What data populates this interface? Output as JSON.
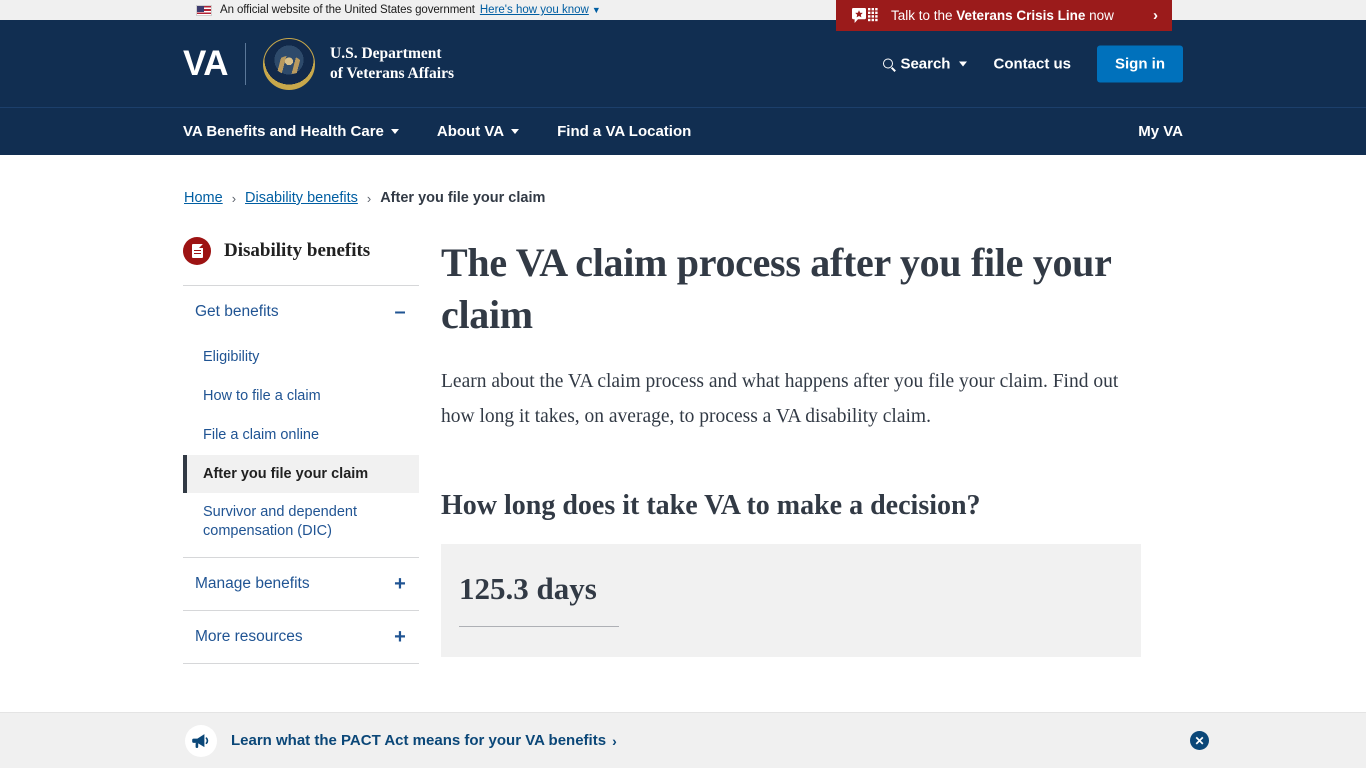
{
  "gov_banner": {
    "text": "An official website of the United States government",
    "how_you_know": "Here's how you know",
    "flag_icon": "us-flag-icon"
  },
  "crisis_banner": {
    "prefix": "Talk to the ",
    "bold": "Veterans Crisis Line",
    "suffix": " now",
    "arrow": "›",
    "icon": "crisis-chat-icon",
    "bg_color": "#9b1b1b"
  },
  "masthead": {
    "logo_text": "VA",
    "seal_icon": "va-seal-icon",
    "dept_line1": "U.S. Department",
    "dept_line2": "of Veterans Affairs",
    "search_label": "Search",
    "search_icon": "search-icon",
    "contact_label": "Contact us",
    "signin_label": "Sign in",
    "signin_color": "#0071bc",
    "bg_color": "#112e51"
  },
  "nav": {
    "items": [
      {
        "label": "VA Benefits and Health Care",
        "has_caret": true
      },
      {
        "label": "About VA",
        "has_caret": true
      },
      {
        "label": "Find a VA Location",
        "has_caret": false
      }
    ],
    "my_va": "My VA"
  },
  "breadcrumb": {
    "home": "Home",
    "parent": "Disability benefits",
    "current": "After you file your claim",
    "separator": "›"
  },
  "sidebar": {
    "title": "Disability benefits",
    "title_icon": "document-icon",
    "groups": [
      {
        "label": "Get benefits",
        "toggle": "–",
        "expanded": true,
        "items": [
          {
            "label": "Eligibility",
            "active": false
          },
          {
            "label": "How to file a claim",
            "active": false
          },
          {
            "label": "File a claim online",
            "active": false
          },
          {
            "label": "After you file your claim",
            "active": true
          },
          {
            "label": "Survivor and dependent compensation (DIC)",
            "active": false
          }
        ]
      },
      {
        "label": "Manage benefits",
        "toggle": "+",
        "expanded": false,
        "items": []
      },
      {
        "label": "More resources",
        "toggle": "+",
        "expanded": false,
        "items": []
      }
    ]
  },
  "main": {
    "heading": "The VA claim process after you file your claim",
    "intro": "Learn about the VA claim process and what happens after you file your claim. Find out how long it takes, on average, to process a VA disability claim.",
    "section_heading": "How long does it take VA to make a decision?",
    "stat_value": "125.3 days"
  },
  "promo_banner": {
    "icon": "megaphone-icon",
    "link_text": "Learn what the PACT Act means for your VA benefits",
    "chevron": "›",
    "close_icon": "close-icon",
    "close_glyph": "✕",
    "bg_color": "#f0f0f0"
  }
}
